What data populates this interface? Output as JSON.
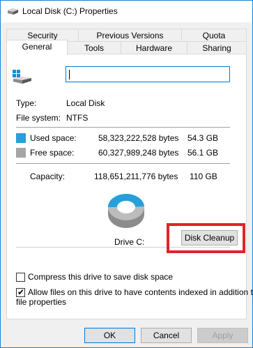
{
  "window": {
    "title": "Local Disk (C:) Properties"
  },
  "tabs": {
    "row1": [
      "Security",
      "Previous Versions",
      "Quota"
    ],
    "row2": [
      "General",
      "Tools",
      "Hardware",
      "Sharing"
    ],
    "active": "General"
  },
  "general": {
    "name_value": "",
    "type_label": "Type:",
    "type_value": "Local Disk",
    "fs_label": "File system:",
    "fs_value": "NTFS",
    "used_label": "Used space:",
    "used_bytes": "58,323,222,528 bytes",
    "used_gb": "54.3 GB",
    "free_label": "Free space:",
    "free_bytes": "60,327,989,248 bytes",
    "free_gb": "56.1 GB",
    "capacity_label": "Capacity:",
    "capacity_bytes": "118,651,211,776 bytes",
    "capacity_gb": "110 GB",
    "drive_label": "Drive C:",
    "disk_cleanup_label": "Disk Cleanup",
    "compress_label": "Compress this drive to save disk space",
    "compress_checked": false,
    "index_label_line1": "Allow files on this drive to have contents indexed in addition to",
    "index_label_line2": "file properties",
    "index_checked": true,
    "used_fraction": 0.4915,
    "used_color": "#26a0da",
    "free_color": "#bcbcbc"
  },
  "buttons": {
    "ok": "OK",
    "cancel": "Cancel",
    "apply": "Apply"
  },
  "icons": {
    "title": "drive-icon",
    "drive": "windows-drive-icon"
  }
}
